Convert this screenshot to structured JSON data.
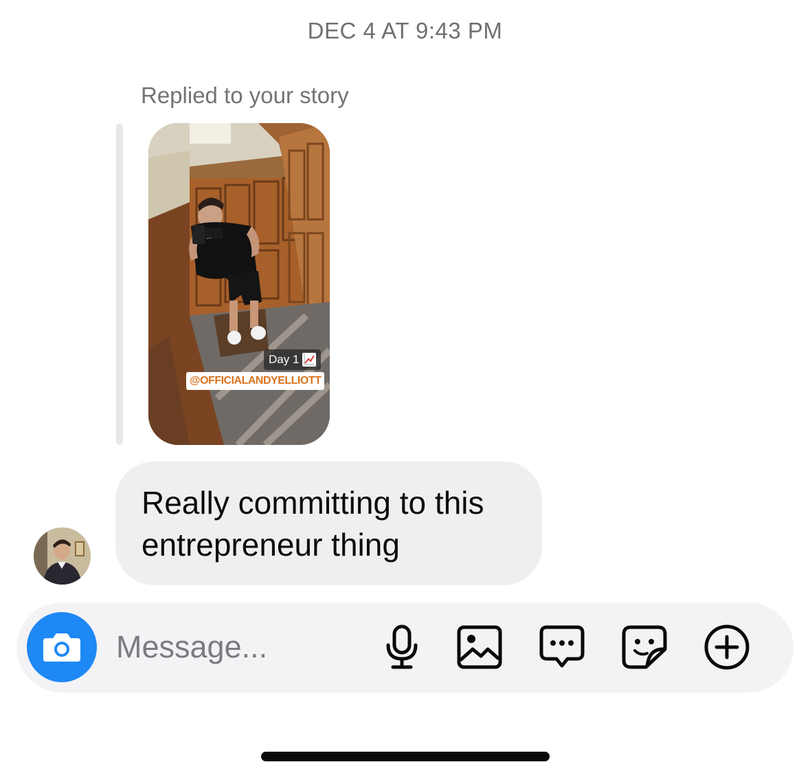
{
  "thread": {
    "timestamp": "DEC 4 AT 9:43 PM"
  },
  "story_reply": {
    "label": "Replied to your story",
    "story": {
      "sticker_day": "Day 1",
      "sticker_mention": "@OFFICIALANDYELLIOTT"
    }
  },
  "message": {
    "text": "Really committing to this entrepreneur thing"
  },
  "composer": {
    "placeholder": "Message...",
    "icons": [
      "camera-icon",
      "microphone-icon",
      "gallery-icon",
      "chat-bubble-icon",
      "sticker-icon",
      "plus-circle-icon"
    ],
    "accent_color": "#1e88f5"
  }
}
